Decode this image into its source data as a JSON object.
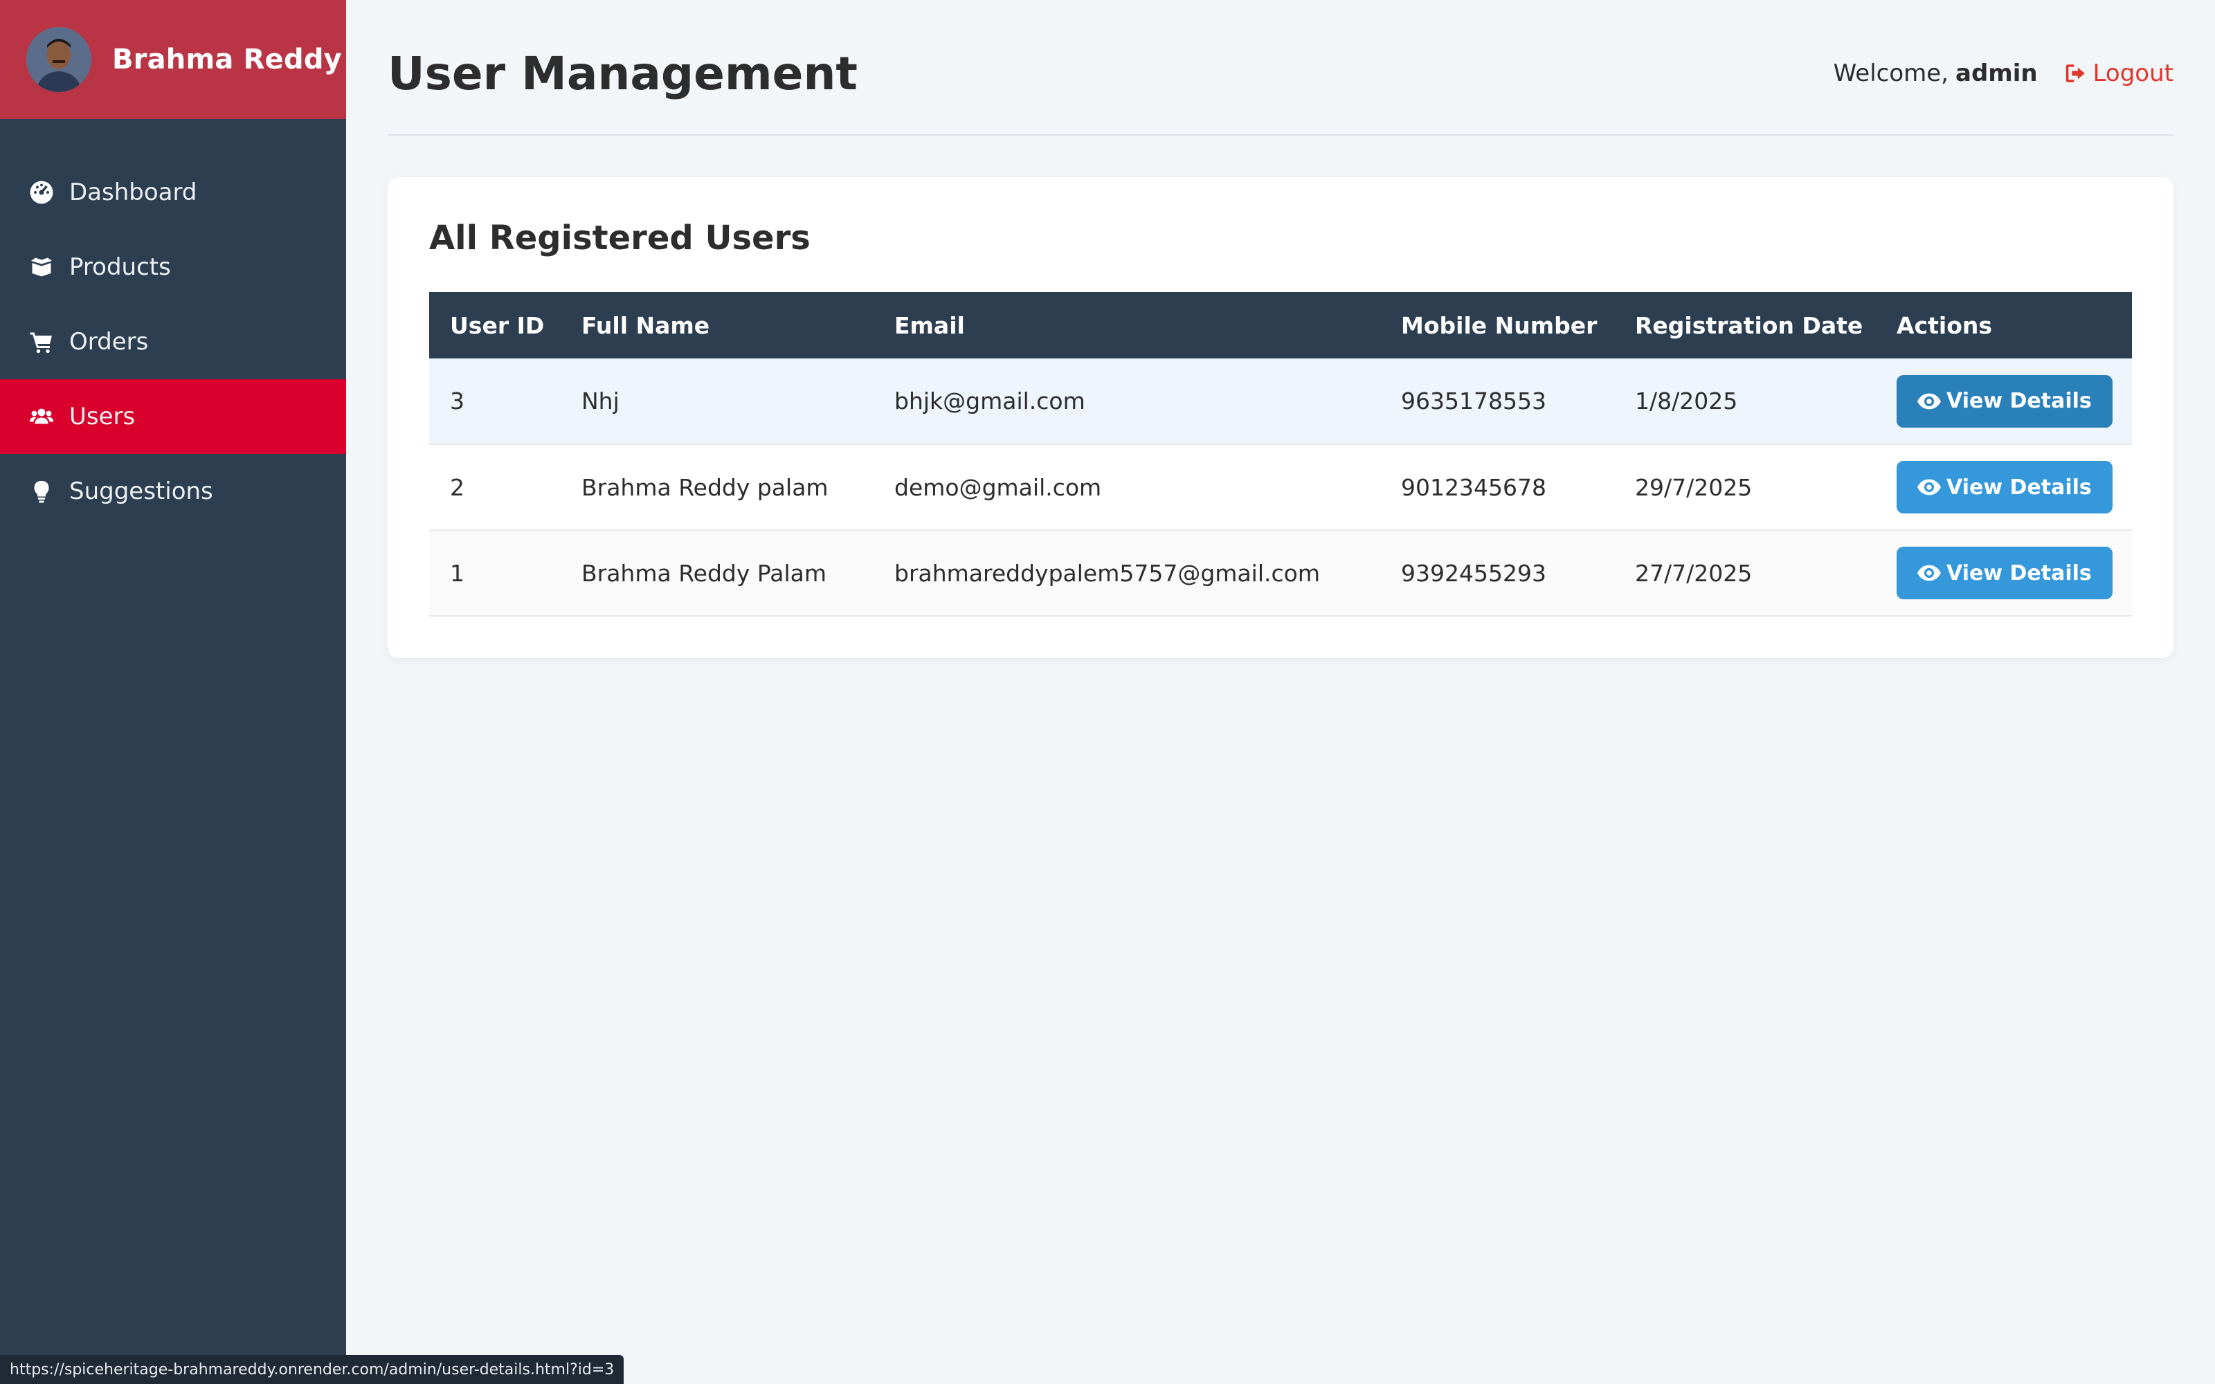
{
  "brand": {
    "name": "Brahma Reddy"
  },
  "sidebar": {
    "items": [
      {
        "label": "Dashboard",
        "icon": "dashboard-icon",
        "active": false
      },
      {
        "label": "Products",
        "icon": "box-icon",
        "active": false
      },
      {
        "label": "Orders",
        "icon": "cart-icon",
        "active": false
      },
      {
        "label": "Users",
        "icon": "users-icon",
        "active": true
      },
      {
        "label": "Suggestions",
        "icon": "lightbulb-icon",
        "active": false
      }
    ]
  },
  "header": {
    "title": "User Management",
    "welcome_prefix": "Welcome,",
    "username": "admin",
    "logout_label": "Logout"
  },
  "users_card": {
    "title": "All Registered Users",
    "columns": [
      "User ID",
      "Full Name",
      "Email",
      "Mobile Number",
      "Registration Date",
      "Actions"
    ],
    "rows": [
      {
        "id": "3",
        "name": "Nhj",
        "email": "bhjk@gmail.com",
        "mobile": "9635178553",
        "date": "1/8/2025",
        "action": "View Details"
      },
      {
        "id": "2",
        "name": "Brahma Reddy palam",
        "email": "demo@gmail.com",
        "mobile": "9012345678",
        "date": "29/7/2025",
        "action": "View Details"
      },
      {
        "id": "1",
        "name": "Brahma Reddy Palam",
        "email": "brahmareddypalem5757@gmail.com",
        "mobile": "9392455293",
        "date": "27/7/2025",
        "action": "View Details"
      }
    ]
  },
  "status_bar": {
    "url": "https://spiceheritage-brahmareddy.onrender.com/admin/user-details.html?id=3"
  },
  "colors": {
    "sidebar_bg": "#2c3e50",
    "brand_bg": "#b93444",
    "active_nav": "#d9002e",
    "button": "#3498db",
    "logout": "#e0362c"
  }
}
